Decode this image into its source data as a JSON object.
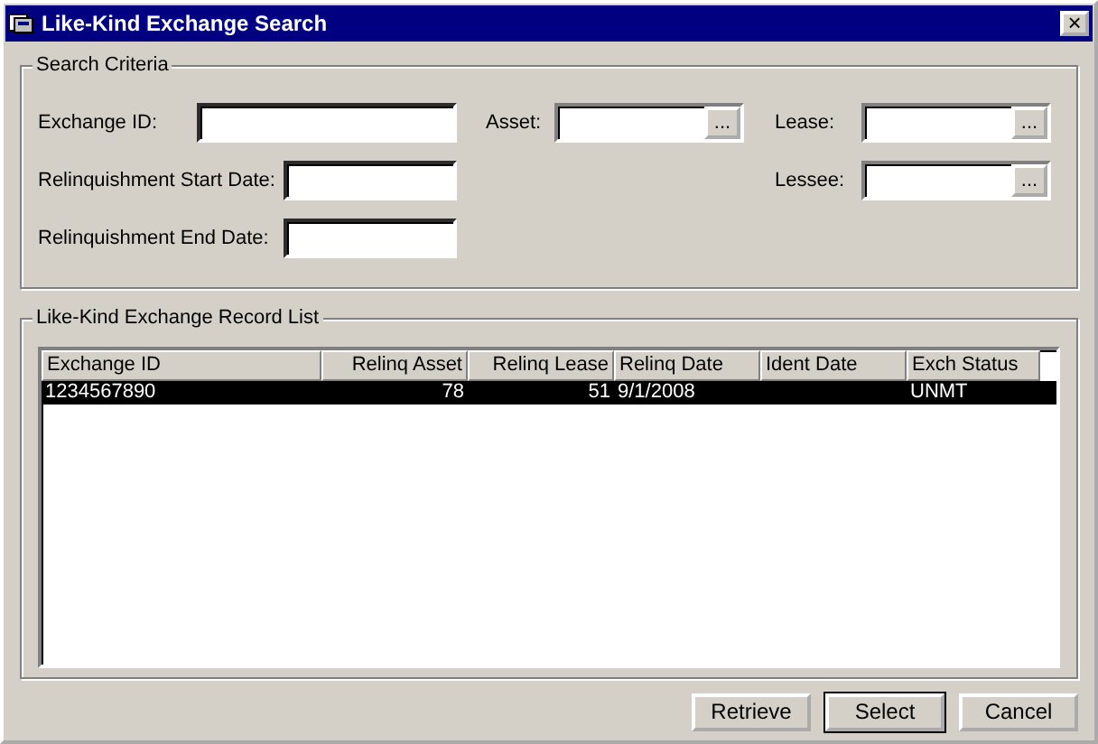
{
  "window": {
    "title": "Like-Kind Exchange Search",
    "close": "×"
  },
  "search_criteria": {
    "title": "Search Criteria",
    "fields": [
      {
        "label": "Exchange ID:",
        "kind": "text"
      },
      {
        "label": "Asset:",
        "kind": "lookup",
        "browse": "..."
      },
      {
        "label": "Lease:",
        "kind": "lookup",
        "browse": "..."
      },
      {
        "label": "Relinquishment Start Date:",
        "kind": "text"
      },
      {
        "label": "Lessee:",
        "kind": "lookup",
        "browse": "..."
      },
      {
        "label": "Relinquishment End Date:",
        "kind": "text"
      }
    ]
  },
  "record_list": {
    "title": "Like-Kind Exchange Record List",
    "columns": [
      "Exchange ID",
      "Relinq Asset",
      "Relinq Lease",
      "Relinq Date",
      "Ident Date",
      "Exch Status"
    ],
    "rows": [
      {
        "selected": true,
        "cells": [
          "1234567890",
          "78",
          "51",
          "9/1/2008",
          "",
          "UNMT"
        ]
      }
    ]
  },
  "buttons": [
    {
      "label": "Retrieve",
      "default": false
    },
    {
      "label": "Select",
      "default": true
    },
    {
      "label": "Cancel",
      "default": false
    }
  ]
}
